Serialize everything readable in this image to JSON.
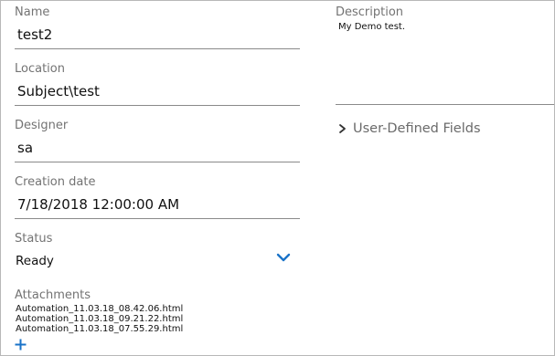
{
  "name": {
    "label": "Name",
    "value": "test2"
  },
  "location": {
    "label": "Location",
    "value": "Subject\\test"
  },
  "designer": {
    "label": "Designer",
    "value": "sa"
  },
  "creation_date": {
    "label": "Creation date",
    "value": "7/18/2018 12:00:00 AM"
  },
  "status": {
    "label": "Status",
    "value": "Ready",
    "dropdown_icon": "chevron-down-icon"
  },
  "attachments": {
    "label": "Attachments",
    "files": [
      "Automation_11.03.18_08.42.06.html",
      "Automation_11.03.18_09.21.22.html",
      "Automation_11.03.18_07.55.29.html"
    ],
    "add_icon": "plus-icon"
  },
  "description": {
    "label": "Description",
    "value": "My Demo test."
  },
  "user_defined_fields": {
    "label": "User-Defined Fields",
    "expand_icon": "chevron-right-icon"
  },
  "colors": {
    "accent": "#1a73c8",
    "label": "#737373",
    "border": "#8a8a8a"
  }
}
